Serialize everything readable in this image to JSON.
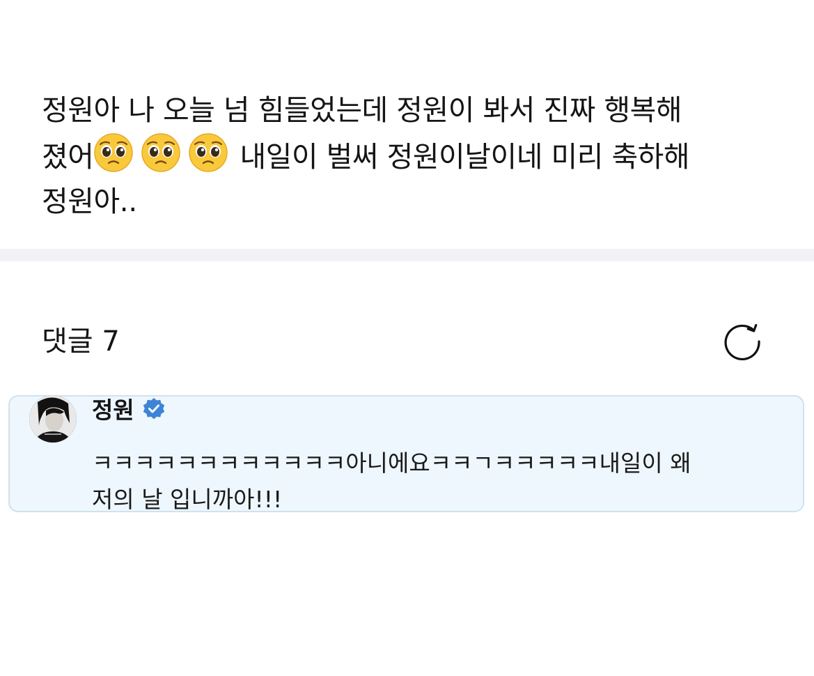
{
  "post": {
    "line1": "정원아 나 오늘 넘 힘들었는데 정원이 봐서 진짜 행복해",
    "line2_start": "졌어",
    "emojis": [
      "pleading-face-emoji",
      "pleading-face-emoji",
      "pleading-face-emoji"
    ],
    "line2_end": "내일이 벌써 정원이날이네 미리 축하해",
    "line3": "정원아.."
  },
  "comments": {
    "title": "댓글 7",
    "refresh_icon": "refresh-icon"
  },
  "comment": {
    "author": "정원",
    "verified_icon": "verified-badge-icon",
    "line1": "ㅋㅋㅋㅋㅋㅋㅋㅋㅋㅋㅋㅋ아니에요ㅋㅋㄱㅋㅋㅋㅋㅋ내일이 왜",
    "line2": "저의 날 입니까아!!!"
  },
  "colors": {
    "card_background": "#eef7fd",
    "card_border": "#cfe2ef",
    "verified_badge": "#3d84d6",
    "divider": "#f2f2f6"
  }
}
